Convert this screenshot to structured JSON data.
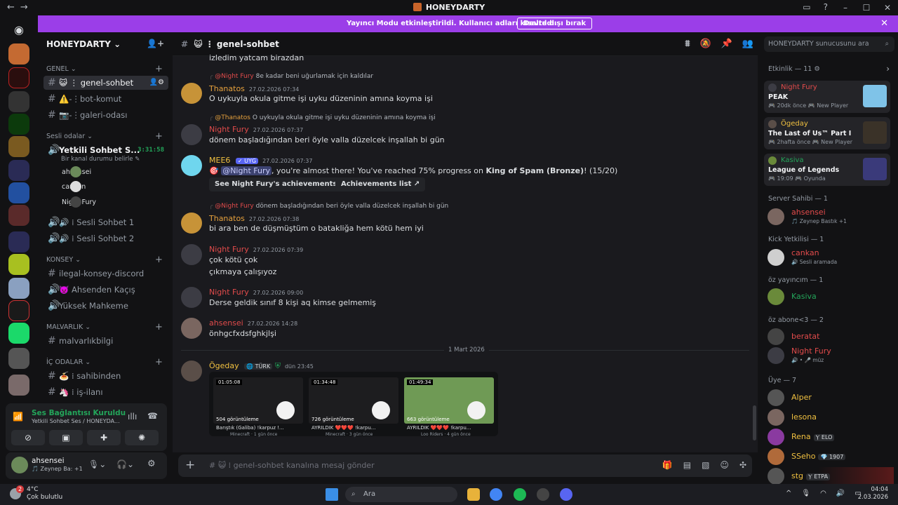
{
  "window": {
    "title": "HONEYDARTY",
    "nav_back": "←",
    "nav_fwd": "→",
    "minimize": "–",
    "maximize": "☐",
    "close": "✕"
  },
  "banner": {
    "text": "Yayıncı Modu etkinleştirildi. Kullanıcı adları kısaltıldı.",
    "button": "Devre dışı bırak",
    "close": "✕"
  },
  "server": {
    "name": "HONEYDARTY ⌄"
  },
  "categories": {
    "genel": "GENEL ⌄",
    "sesli": "Sesli odalar ⌄",
    "konsey": "KONSEY ⌄",
    "malvarlik": "MALVARLIK ⌄",
    "ic_odalar": "İÇ ODALAR ⌄"
  },
  "channels": {
    "genel_sohbet": "😺 ⋮ genel-sohbet",
    "bot_komut": "⚠️-⋮bot-komut",
    "galeri": "📷-⋮galeri-odası",
    "yetkili": "Yetkili Sohbet S...",
    "yetkili_time": "3:31:58",
    "yetkili_status": "Bir kanal durumu belirle ✎",
    "sesli1": "🔊 ⁞ Sesli Sohbet 1",
    "sesli2": "🔊 ⁞ Sesli Sohbet 2",
    "ilegal": "ilegal-konsey-discord",
    "ahsenden": "👿 Ahsenden Kaçış",
    "yuksek": "Yüksek Mahkeme",
    "malvarlik": "malvarlıkbilgi",
    "sahibinden": "🍝 ⁞ sahibinden",
    "is_ilani": "🦄 ⁞ iş-ilanı"
  },
  "voice_users": [
    "ahsensei",
    "cankan",
    "Night Fury"
  ],
  "voice_panel": {
    "title": "Ses Bağlantısı Kuruldu",
    "subtitle": "Yetkili Sohbet Ses / HONEYDA..."
  },
  "user_panel": {
    "name": "ahsensei",
    "status": "🎵 Zeynep Ba: +1"
  },
  "chat": {
    "channel": "😺 ⋮ genel-sohbet",
    "placeholder": "# 😺 ⁞ genel-sohbet kanalına mesaj gönder",
    "top_line": "izledim yatcam birazdan",
    "date_divider": "1 Mart 2026",
    "messages": [
      {
        "reply_name": "@Night Fury",
        "reply_text": "8e kadar beni uğurlamak için kaldılar",
        "author": "Thanatos",
        "ts": "27.02.2026 07:34",
        "lines": [
          "O uykuyla okula gitme işi uyku düzeninin amına koyma işi"
        ]
      },
      {
        "reply_name": "@Thanatos",
        "reply_text": "O uykuyla okula gitme işi uyku düzeninin amına koyma işi",
        "author": "Night Fury",
        "ts": "27.02.2026 07:37",
        "lines": [
          "dönem başladığından beri öyle valla düzelcek inşallah bi gün"
        ]
      },
      {
        "author": "MEE6",
        "tag": "✓ UYG",
        "ts": "27.02.2026 07:37",
        "pre": "🎯",
        "mention": "@Night Fury",
        "text": ", you're almost there! You've reached 75% progress on ",
        "bold": "King of Spam (Bronze)",
        "tail": "! (15/20)",
        "btn1": "See Night Fury's achievements ↗",
        "btn2": "Achievements list ↗"
      },
      {
        "reply_name": "@Night Fury",
        "reply_text": "dönem başladığından beri öyle valla düzelcek inşallah bi gün",
        "author": "Thanatos",
        "ts": "27.02.2026 07:38",
        "lines": [
          "bi ara ben de düşmüştüm o batakliğa hem kötü hem iyi"
        ]
      },
      {
        "author": "Night Fury",
        "ts": "27.02.2026 07:39",
        "lines": [
          "çok kötü çok",
          "çıkmaya çalışıyoz"
        ]
      },
      {
        "author": "Night Fury",
        "ts": "27.02.2026 09:00",
        "lines": [
          "Derse geldik sınıf 8 kişi aq kimse gelmemiş"
        ]
      },
      {
        "author": "ahsensei",
        "ts": "27.02.2026 14:28",
        "lines": [
          "önhgcfxdsfghkjlşi"
        ]
      },
      {
        "author": "Ögeday",
        "tag": "🌐 TÜRK",
        "ts": "dün 23:45"
      }
    ],
    "videos": [
      {
        "dur": "01:05:08",
        "views": "504 görüntüleme",
        "title": "Barıştık (Galiba) !karpuz !...",
        "sub": "Minecraft · 1 gün önce"
      },
      {
        "dur": "01:34:48",
        "views": "726 görüntüleme",
        "title": "AYRILDIK ❤️❤️❤️ !karpu...",
        "sub": "Minecraft · 3 gün önce"
      },
      {
        "dur": "01:49:34",
        "views": "663 görüntüleme",
        "title": "AYRILDIK ❤️❤️❤️ !karpu...",
        "sub": "Loo Riders · 4 gün önce"
      }
    ]
  },
  "search": {
    "placeholder": "HONEYDARTY sunucusunu ara"
  },
  "members": {
    "activity_title": "Etkinlik — 11 ⚙",
    "activities": [
      {
        "user": "Night Fury",
        "game": "PEAK",
        "sub": "🎮 20dk önce  🎮 New Player"
      },
      {
        "user": "Ögeday",
        "game": "The Last of Us™ Part I",
        "sub": "🎮 2hafta önce  🎮 New Player"
      },
      {
        "user": "Kasiva",
        "game": "League of Legends",
        "sub": "🎮 19:09  🎮 Oyunda"
      }
    ],
    "sec_owner": "Server Sahibi — 1",
    "owner": {
      "name": "ahsensei",
      "sub": "🎵 Zeynep Bastık +1"
    },
    "sec_kick": "Kick Yetkilisi — 1",
    "kick": {
      "name": "cankan",
      "sub": "🔊 Sesli aramada"
    },
    "sec_oz": "öz yayıncım — 1",
    "oz": {
      "name": "Kasiva"
    },
    "sec_abone": "öz abone<3 — 2",
    "abone": [
      {
        "name": "beratat"
      },
      {
        "name": "Night Fury",
        "sub": "🔊 • 🎤 müz"
      }
    ],
    "sec_uye": "Üye — 7",
    "uye": [
      {
        "name": "Alper"
      },
      {
        "name": "lesona"
      },
      {
        "name": "Rena",
        "badge": "Ⲩ ELO"
      },
      {
        "name": "SSeho",
        "badge": "💎 1907"
      },
      {
        "name": "stg",
        "badge": "Ⲩ ETPA"
      }
    ]
  },
  "taskbar": {
    "temp": "4°C",
    "weather": "Çok bulutlu",
    "badge": "2",
    "search": "Ara",
    "time": "04:04",
    "date": "2.03.2026"
  },
  "colors": {
    "accent": "#9b3ee8",
    "thanatos": "#e6a13d",
    "nightfury": "#e24b4b",
    "mee6": "#f0c040",
    "ogeday": "#f0c040",
    "green": "#23a55a"
  }
}
